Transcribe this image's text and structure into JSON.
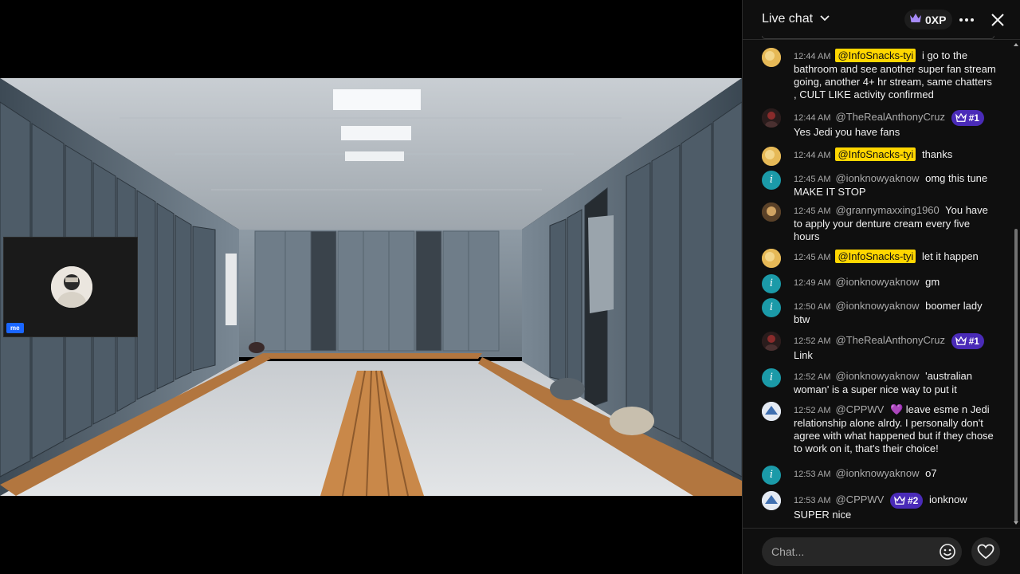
{
  "chat": {
    "title": "Live chat",
    "xp": "0XP",
    "input_placeholder": "Chat...",
    "messages": [
      {
        "time": "12:44 AM",
        "author": "@InfoSnacks-tyi",
        "highlight": true,
        "text": "i go to the bathroom and see another super fan stream going, another 4+ hr stream, same chatters , CULT LIKE activity confirmed",
        "avatar": "yellow"
      },
      {
        "time": "12:44 AM",
        "author": "@TheRealAnthonyCruz",
        "rank": "#1",
        "text": "Yes Jedi you have fans",
        "avatar": "dark"
      },
      {
        "time": "12:44 AM",
        "author": "@InfoSnacks-tyi",
        "highlight": true,
        "text": "thanks",
        "avatar": "yellow"
      },
      {
        "time": "12:45 AM",
        "author": "@ionknowyaknow",
        "text": "omg this tune MAKE IT STOP",
        "avatar": "teal"
      },
      {
        "time": "12:45 AM",
        "author": "@grannymaxxing1960",
        "text": "You have to apply your denture cream every five hours",
        "avatar": "gran"
      },
      {
        "time": "12:45 AM",
        "author": "@InfoSnacks-tyi",
        "highlight": true,
        "text": "let it happen",
        "avatar": "yellow"
      },
      {
        "time": "12:49 AM",
        "author": "@ionknowyaknow",
        "text": "gm",
        "avatar": "teal"
      },
      {
        "time": "12:50 AM",
        "author": "@ionknowyaknow",
        "text": "boomer lady btw",
        "avatar": "teal"
      },
      {
        "time": "12:52 AM",
        "author": "@TheRealAnthonyCruz",
        "rank": "#1",
        "text": "Link",
        "avatar": "dark"
      },
      {
        "time": "12:52 AM",
        "author": "@ionknowyaknow",
        "text": "'australian woman' is a super nice way to put it",
        "avatar": "teal"
      },
      {
        "time": "12:52 AM",
        "author": "@CPPWV",
        "emoji": "💜",
        "text": "leave esme n Jedi relationship alone alrdy. I personally don't agree with what happened but if they chose to work on it, that's their choice!",
        "avatar": "cp"
      },
      {
        "time": "12:53 AM",
        "author": "@ionknowyaknow",
        "text": "o7",
        "avatar": "teal"
      },
      {
        "time": "12:53 AM",
        "author": "@CPPWV",
        "rank": "#2",
        "text": "ionknow SUPER nice",
        "avatar": "cp"
      }
    ]
  },
  "video": {
    "pip_label": "me"
  },
  "icons": {
    "teal_avatar_letter": "i"
  }
}
